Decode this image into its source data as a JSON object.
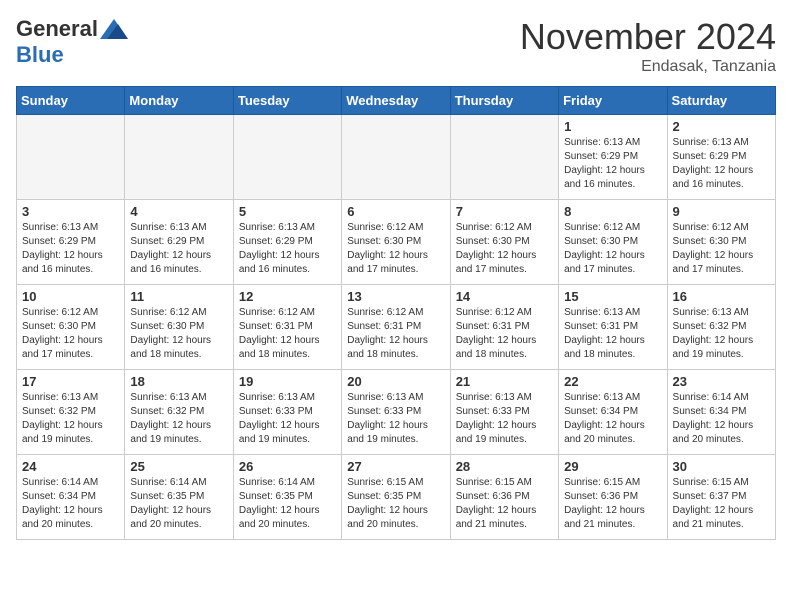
{
  "header": {
    "logo_general": "General",
    "logo_blue": "Blue",
    "month_title": "November 2024",
    "location": "Endasak, Tanzania"
  },
  "weekdays": [
    "Sunday",
    "Monday",
    "Tuesday",
    "Wednesday",
    "Thursday",
    "Friday",
    "Saturday"
  ],
  "weeks": [
    [
      {
        "day": "",
        "info": ""
      },
      {
        "day": "",
        "info": ""
      },
      {
        "day": "",
        "info": ""
      },
      {
        "day": "",
        "info": ""
      },
      {
        "day": "",
        "info": ""
      },
      {
        "day": "1",
        "info": "Sunrise: 6:13 AM\nSunset: 6:29 PM\nDaylight: 12 hours\nand 16 minutes."
      },
      {
        "day": "2",
        "info": "Sunrise: 6:13 AM\nSunset: 6:29 PM\nDaylight: 12 hours\nand 16 minutes."
      }
    ],
    [
      {
        "day": "3",
        "info": "Sunrise: 6:13 AM\nSunset: 6:29 PM\nDaylight: 12 hours\nand 16 minutes."
      },
      {
        "day": "4",
        "info": "Sunrise: 6:13 AM\nSunset: 6:29 PM\nDaylight: 12 hours\nand 16 minutes."
      },
      {
        "day": "5",
        "info": "Sunrise: 6:13 AM\nSunset: 6:29 PM\nDaylight: 12 hours\nand 16 minutes."
      },
      {
        "day": "6",
        "info": "Sunrise: 6:12 AM\nSunset: 6:30 PM\nDaylight: 12 hours\nand 17 minutes."
      },
      {
        "day": "7",
        "info": "Sunrise: 6:12 AM\nSunset: 6:30 PM\nDaylight: 12 hours\nand 17 minutes."
      },
      {
        "day": "8",
        "info": "Sunrise: 6:12 AM\nSunset: 6:30 PM\nDaylight: 12 hours\nand 17 minutes."
      },
      {
        "day": "9",
        "info": "Sunrise: 6:12 AM\nSunset: 6:30 PM\nDaylight: 12 hours\nand 17 minutes."
      }
    ],
    [
      {
        "day": "10",
        "info": "Sunrise: 6:12 AM\nSunset: 6:30 PM\nDaylight: 12 hours\nand 17 minutes."
      },
      {
        "day": "11",
        "info": "Sunrise: 6:12 AM\nSunset: 6:30 PM\nDaylight: 12 hours\nand 18 minutes."
      },
      {
        "day": "12",
        "info": "Sunrise: 6:12 AM\nSunset: 6:31 PM\nDaylight: 12 hours\nand 18 minutes."
      },
      {
        "day": "13",
        "info": "Sunrise: 6:12 AM\nSunset: 6:31 PM\nDaylight: 12 hours\nand 18 minutes."
      },
      {
        "day": "14",
        "info": "Sunrise: 6:12 AM\nSunset: 6:31 PM\nDaylight: 12 hours\nand 18 minutes."
      },
      {
        "day": "15",
        "info": "Sunrise: 6:13 AM\nSunset: 6:31 PM\nDaylight: 12 hours\nand 18 minutes."
      },
      {
        "day": "16",
        "info": "Sunrise: 6:13 AM\nSunset: 6:32 PM\nDaylight: 12 hours\nand 19 minutes."
      }
    ],
    [
      {
        "day": "17",
        "info": "Sunrise: 6:13 AM\nSunset: 6:32 PM\nDaylight: 12 hours\nand 19 minutes."
      },
      {
        "day": "18",
        "info": "Sunrise: 6:13 AM\nSunset: 6:32 PM\nDaylight: 12 hours\nand 19 minutes."
      },
      {
        "day": "19",
        "info": "Sunrise: 6:13 AM\nSunset: 6:33 PM\nDaylight: 12 hours\nand 19 minutes."
      },
      {
        "day": "20",
        "info": "Sunrise: 6:13 AM\nSunset: 6:33 PM\nDaylight: 12 hours\nand 19 minutes."
      },
      {
        "day": "21",
        "info": "Sunrise: 6:13 AM\nSunset: 6:33 PM\nDaylight: 12 hours\nand 19 minutes."
      },
      {
        "day": "22",
        "info": "Sunrise: 6:13 AM\nSunset: 6:34 PM\nDaylight: 12 hours\nand 20 minutes."
      },
      {
        "day": "23",
        "info": "Sunrise: 6:14 AM\nSunset: 6:34 PM\nDaylight: 12 hours\nand 20 minutes."
      }
    ],
    [
      {
        "day": "24",
        "info": "Sunrise: 6:14 AM\nSunset: 6:34 PM\nDaylight: 12 hours\nand 20 minutes."
      },
      {
        "day": "25",
        "info": "Sunrise: 6:14 AM\nSunset: 6:35 PM\nDaylight: 12 hours\nand 20 minutes."
      },
      {
        "day": "26",
        "info": "Sunrise: 6:14 AM\nSunset: 6:35 PM\nDaylight: 12 hours\nand 20 minutes."
      },
      {
        "day": "27",
        "info": "Sunrise: 6:15 AM\nSunset: 6:35 PM\nDaylight: 12 hours\nand 20 minutes."
      },
      {
        "day": "28",
        "info": "Sunrise: 6:15 AM\nSunset: 6:36 PM\nDaylight: 12 hours\nand 21 minutes."
      },
      {
        "day": "29",
        "info": "Sunrise: 6:15 AM\nSunset: 6:36 PM\nDaylight: 12 hours\nand 21 minutes."
      },
      {
        "day": "30",
        "info": "Sunrise: 6:15 AM\nSunset: 6:37 PM\nDaylight: 12 hours\nand 21 minutes."
      }
    ]
  ]
}
